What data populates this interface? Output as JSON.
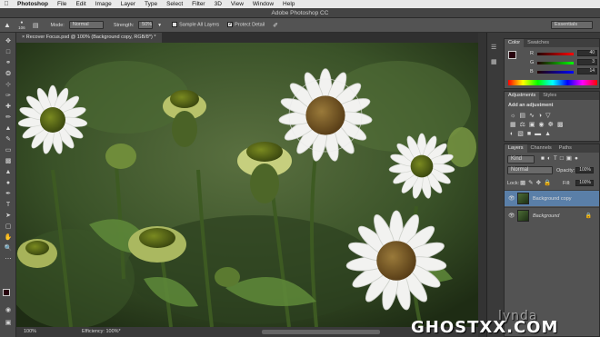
{
  "menubar": {
    "apple_glyph": "",
    "items": [
      "Photoshop",
      "File",
      "Edit",
      "Image",
      "Layer",
      "Type",
      "Select",
      "Filter",
      "3D",
      "View",
      "Window",
      "Help"
    ]
  },
  "window": {
    "title": "Adobe Photoshop CC"
  },
  "options": {
    "brush_size": "106",
    "mode_label": "Mode:",
    "mode_value": "Normal",
    "strength_label": "Strength:",
    "strength_value": "50%",
    "sample_all_layers": "Sample All Layers",
    "protect_detail": "Protect Detail",
    "workspace": "Essentials"
  },
  "document": {
    "tab_label": "Recover Focus.psd @ 100% (Background copy, RGB/8*) *"
  },
  "status": {
    "zoom": "100%",
    "efficiency": "Efficiency: 100%*"
  },
  "color_panel": {
    "tabs": [
      "Color",
      "Swatches"
    ],
    "r_label": "R",
    "r_value": "40",
    "g_label": "G",
    "g_value": "3",
    "b_label": "B",
    "b_value": "14"
  },
  "adjustments_panel": {
    "tabs": [
      "Adjustments",
      "Styles"
    ],
    "heading": "Add an adjustment"
  },
  "layers_panel": {
    "tabs": [
      "Layers",
      "Channels",
      "Paths"
    ],
    "kind_label": "Kind",
    "blend_mode": "Normal",
    "opacity_label": "Opacity:",
    "opacity_value": "100%",
    "lock_label": "Lock:",
    "fill_label": "Fill:",
    "fill_value": "100%",
    "layers": [
      {
        "name": "Background copy",
        "selected": true
      },
      {
        "name": "Background",
        "selected": false
      }
    ]
  },
  "watermark": {
    "text": "GHOSTXX.COM",
    "overlay": "lynda"
  },
  "colors": {
    "accent_selection": "#5a7fa8",
    "foreground": "#28030e",
    "background": "#ffffff"
  }
}
